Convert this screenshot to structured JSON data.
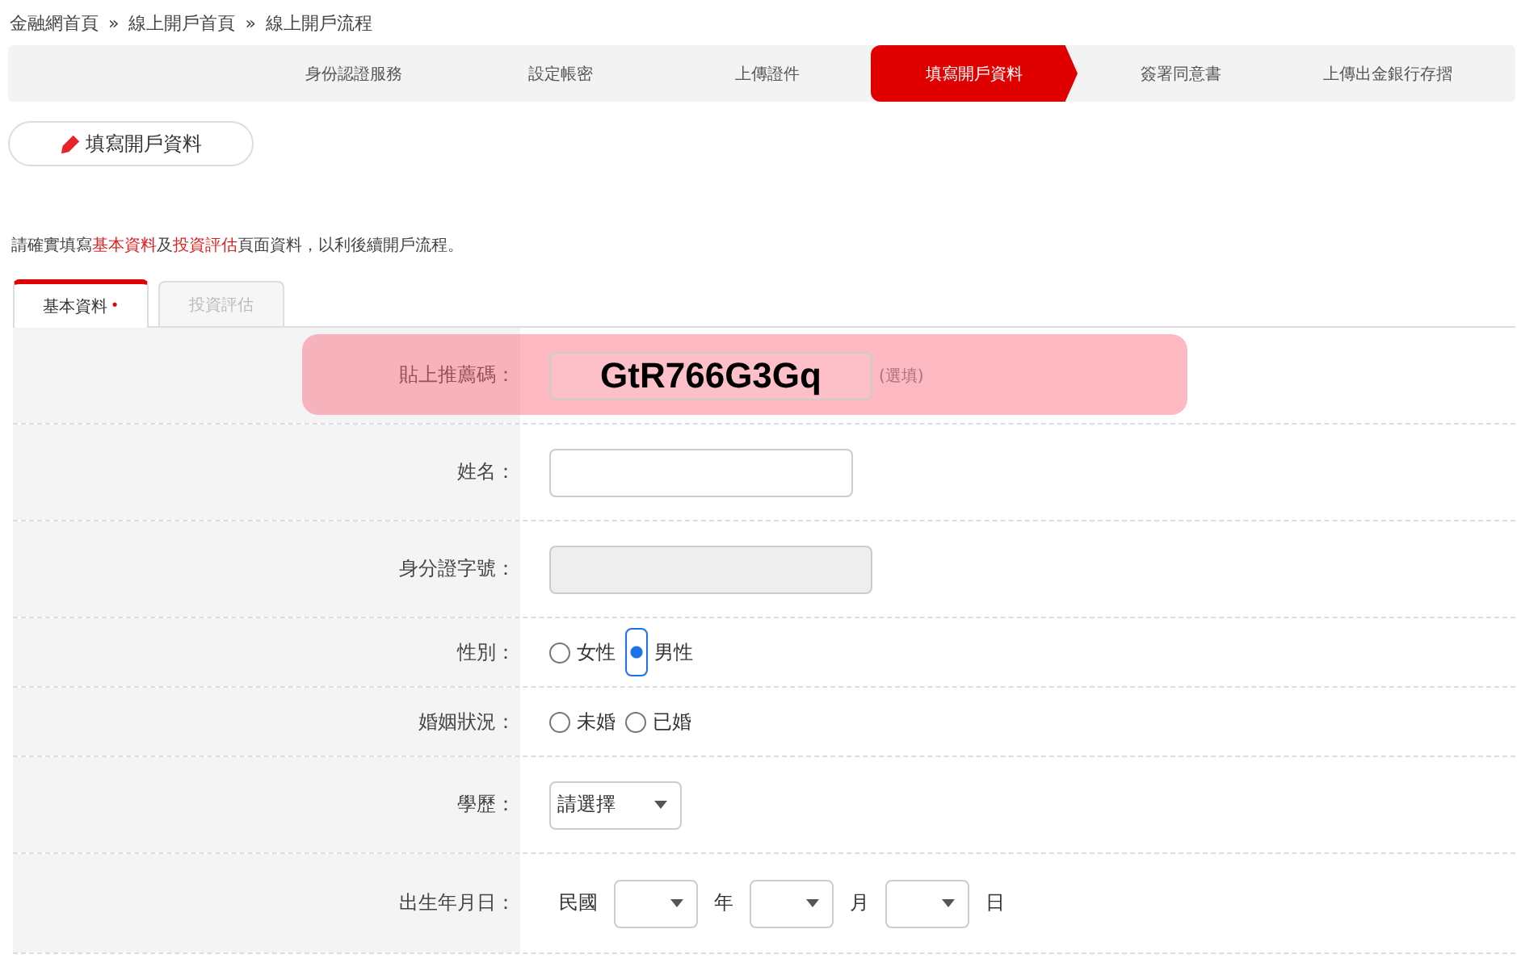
{
  "breadcrumb": [
    {
      "label": "金融網首頁"
    },
    {
      "label": "線上開戶首頁"
    },
    {
      "label": "線上開戶流程"
    }
  ],
  "breadcrumb_separator": "»",
  "steps": [
    {
      "label": "身份認證服務",
      "selected": false
    },
    {
      "label": "設定帳密",
      "selected": false
    },
    {
      "label": "上傳證件",
      "selected": false
    },
    {
      "label": "填寫開戶資料",
      "selected": true
    },
    {
      "label": "簽署同意書",
      "selected": false
    },
    {
      "label": "上傳出金銀行存摺",
      "selected": false
    }
  ],
  "section_button": {
    "label": "填寫開戶資料"
  },
  "instruction": [
    {
      "text": "請確實填寫",
      "highlight": false
    },
    {
      "text": "基本資料",
      "highlight": true
    },
    {
      "text": "及",
      "highlight": false
    },
    {
      "text": "投資評估",
      "highlight": true
    },
    {
      "text": "頁面資料，以利後續開戶流程。",
      "highlight": false
    }
  ],
  "tabs": [
    {
      "label": "基本資料",
      "selected": true,
      "required_mark": "•"
    },
    {
      "label": "投資評估",
      "selected": false
    }
  ],
  "fields": [
    {
      "kind": "text",
      "label": "貼上推薦碼：",
      "value": "GtR766G3Gq",
      "hint": "(選填)",
      "highlighted": true,
      "disabled": false
    },
    {
      "kind": "text",
      "label": "姓名：",
      "highlighted": false,
      "disabled": false
    },
    {
      "kind": "text",
      "label": "身分證字號：",
      "highlighted": false,
      "disabled": true
    },
    {
      "kind": "radio",
      "label": "性別：",
      "options": [
        {
          "label": "女性",
          "selected": false
        },
        {
          "label": "男性",
          "selected": true
        }
      ]
    },
    {
      "kind": "radio",
      "label": "婚姻狀況：",
      "options": [
        {
          "label": "未婚",
          "selected": false
        },
        {
          "label": "已婚",
          "selected": false
        }
      ]
    },
    {
      "kind": "select",
      "label": "學歷：",
      "value": "請選擇"
    },
    {
      "kind": "date",
      "label": "出生年月日：",
      "prefix": "民國",
      "units": [
        "年",
        "月",
        "日"
      ]
    }
  ]
}
